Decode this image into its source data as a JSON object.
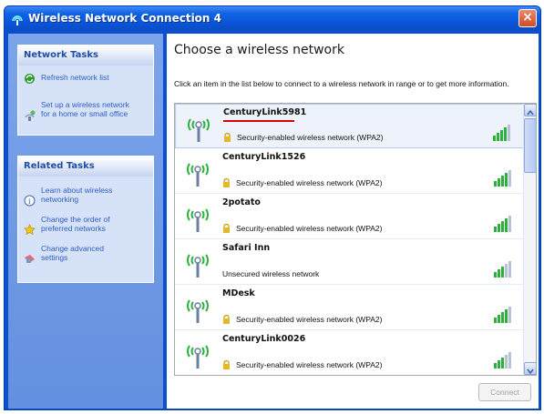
{
  "window": {
    "title": "Wireless Network Connection 4",
    "close_glyph": "×"
  },
  "sidebar": {
    "network_tasks": {
      "header": "Network Tasks",
      "items": [
        {
          "label": "Refresh network list",
          "icon": "refresh-icon"
        },
        {
          "label": "Set up a wireless network\nfor a home or small office",
          "icon": "setup-network-icon"
        }
      ]
    },
    "related_tasks": {
      "header": "Related Tasks",
      "items": [
        {
          "label": "Learn about wireless\nnetworking",
          "icon": "info-icon"
        },
        {
          "label": "Change the order of\npreferred networks",
          "icon": "star-icon"
        },
        {
          "label": "Change advanced\nsettings",
          "icon": "settings-icon"
        }
      ]
    }
  },
  "main": {
    "title": "Choose a wireless network",
    "instructions": "Click an item in the list below to connect to a wireless network in range or to get more information."
  },
  "networks": [
    {
      "name": "CenturyLink5981",
      "security": "Security-enabled wireless network (WPA2)",
      "secured": true,
      "signal": 4
    },
    {
      "name": "CenturyLink1526",
      "security": "Security-enabled wireless network (WPA2)",
      "secured": true,
      "signal": 4
    },
    {
      "name": "2potato",
      "security": "Security-enabled wireless network (WPA2)",
      "secured": true,
      "signal": 4
    },
    {
      "name": "Safari Inn",
      "security": "Unsecured wireless network",
      "secured": false,
      "signal": 3
    },
    {
      "name": "MDesk",
      "security": "Security-enabled wireless network (WPA2)",
      "secured": true,
      "signal": 4
    },
    {
      "name": "CenturyLink0026",
      "security": "Security-enabled wireless network (WPA2)",
      "secured": true,
      "signal": 3
    }
  ],
  "buttons": {
    "connect": "Connect"
  },
  "colors": {
    "title_bar": "#1163e6",
    "side_pane": "#7ba4ea",
    "signal_active": "#2bb13c",
    "signal_inactive": "#b8c2d6",
    "lock": "#e3b92b",
    "selection_underline": "#dd0000"
  }
}
